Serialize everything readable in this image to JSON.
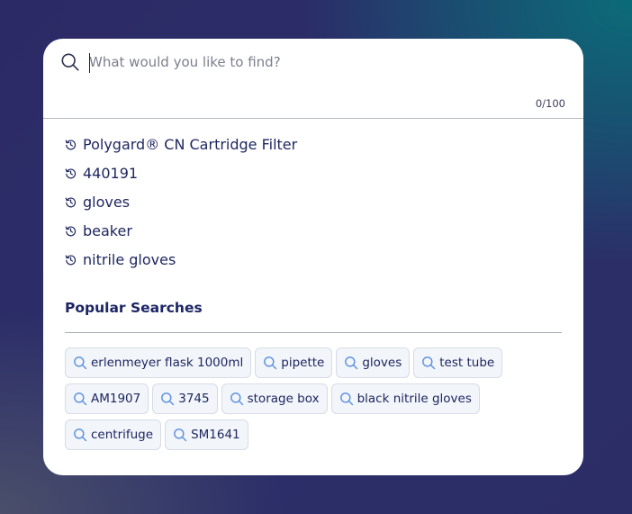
{
  "search": {
    "placeholder": "What would you like to find?",
    "value": "",
    "counter": "0/100"
  },
  "history": [
    {
      "label": "Polygard® CN Cartridge Filter",
      "icon": "history-icon"
    },
    {
      "label": "440191",
      "icon": "history-icon"
    },
    {
      "label": "gloves",
      "icon": "history-icon"
    },
    {
      "label": "beaker",
      "icon": "history-icon"
    },
    {
      "label": "nitrile gloves",
      "icon": "history-icon"
    }
  ],
  "popular": {
    "title": "Popular Searches",
    "chips": [
      "erlenmeyer flask 1000ml",
      "pipette",
      "gloves",
      "test tube",
      "AM1907",
      "3745",
      "storage box",
      "black nitrile gloves",
      "centrifuge",
      "SM1641"
    ]
  },
  "colors": {
    "accent": "#1c2566",
    "chip_icon": "#5a8fe0",
    "chip_bg": "#f2f5fa"
  }
}
